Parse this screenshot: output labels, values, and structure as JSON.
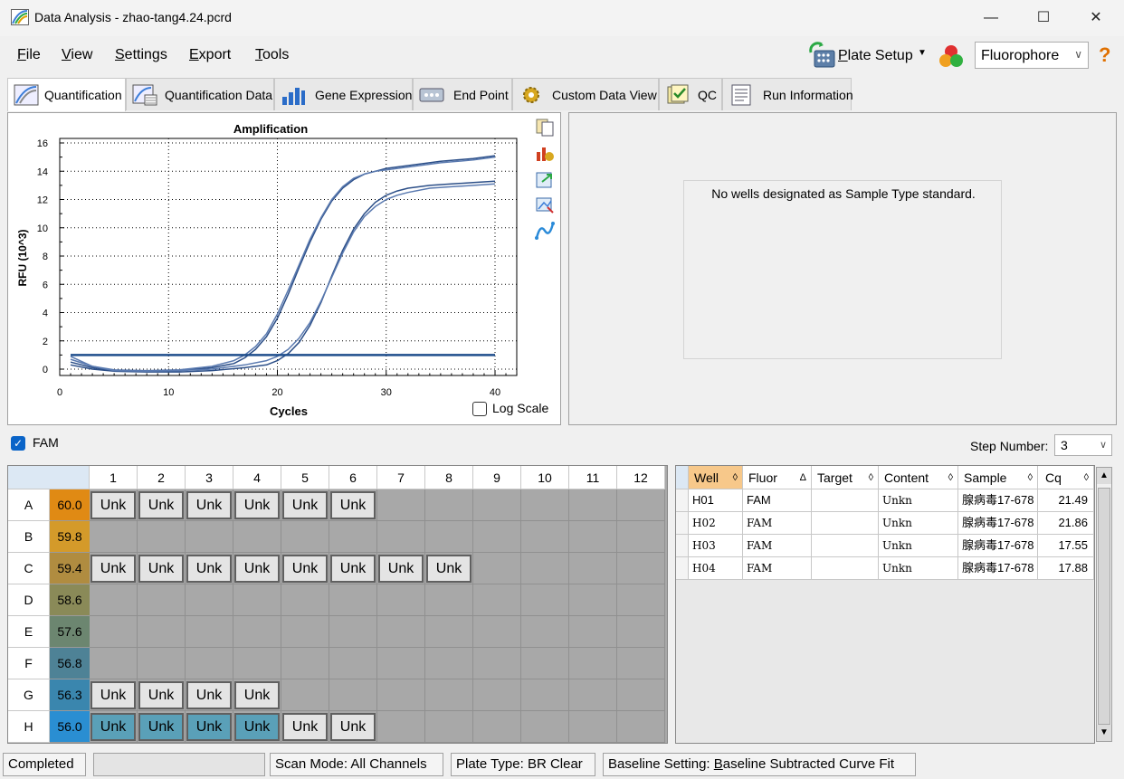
{
  "window": {
    "title": "Data Analysis - zhao-tang4.24.pcrd",
    "minimize": "—",
    "maximize": "☐",
    "close": "✕"
  },
  "menu": {
    "file": {
      "ul": "F",
      "rest": "ile"
    },
    "view": {
      "ul": "V",
      "rest": "iew"
    },
    "settings": {
      "ul": "S",
      "rest": "ettings"
    },
    "export": {
      "ul": "E",
      "rest": "xport"
    },
    "tools": {
      "ul": "T",
      "rest": "ools"
    }
  },
  "toolbar": {
    "plate_setup_ul": "P",
    "plate_setup_rest": "late Setup",
    "fluorophore": "Fluorophore",
    "help": "?"
  },
  "tabs": [
    {
      "label": "Quantification",
      "icon": "amplification-icon"
    },
    {
      "label": "Quantification Data",
      "icon": "quant-data-icon"
    },
    {
      "label": "Gene Expression",
      "icon": "bar-chart-icon"
    },
    {
      "label": "End Point",
      "icon": "end-point-icon"
    },
    {
      "label": "Custom Data View",
      "icon": "gear-icon"
    },
    {
      "label": "QC",
      "icon": "qc-check-icon"
    },
    {
      "label": "Run Information",
      "icon": "run-info-icon"
    }
  ],
  "chart_data": {
    "type": "line",
    "title": "Amplification",
    "xlabel": "Cycles",
    "ylabel": "RFU (10^3)",
    "xlim": [
      0,
      42
    ],
    "ylim": [
      -0.5,
      16
    ],
    "xticks": [
      0,
      10,
      20,
      30,
      40
    ],
    "yticks": [
      0,
      2,
      4,
      6,
      8,
      10,
      12,
      14,
      16
    ],
    "grid": true,
    "threshold": 1.0,
    "series": [
      {
        "x": [
          1,
          3,
          5,
          8,
          11,
          14,
          16,
          17,
          18,
          19,
          20,
          21,
          22,
          23,
          24,
          25,
          26,
          27,
          28,
          29,
          30,
          32,
          35,
          38,
          40
        ],
        "values": [
          0.5,
          0.1,
          -0.1,
          -0.15,
          -0.1,
          0.1,
          0.4,
          0.8,
          1.4,
          2.3,
          3.6,
          5.3,
          7.2,
          9.0,
          10.6,
          11.9,
          12.8,
          13.4,
          13.8,
          14.0,
          14.2,
          14.4,
          14.7,
          14.9,
          15.1
        ]
      },
      {
        "x": [
          1,
          3,
          5,
          8,
          11,
          14,
          16,
          17,
          18,
          19,
          20,
          21,
          22,
          23,
          24,
          25,
          26,
          27,
          28,
          29,
          30,
          32,
          35,
          38,
          40
        ],
        "values": [
          0.7,
          0.2,
          -0.05,
          -0.1,
          -0.05,
          0.2,
          0.6,
          1.0,
          1.6,
          2.5,
          3.9,
          5.6,
          7.4,
          9.2,
          10.7,
          12.0,
          12.9,
          13.5,
          13.8,
          14.0,
          14.1,
          14.3,
          14.6,
          14.8,
          15.0
        ]
      },
      {
        "x": [
          1,
          3,
          5,
          8,
          11,
          14,
          17,
          19,
          20,
          21,
          22,
          23,
          24,
          25,
          26,
          27,
          28,
          29,
          30,
          31,
          32,
          34,
          36,
          38,
          40
        ],
        "values": [
          0.3,
          0.0,
          -0.15,
          -0.2,
          -0.2,
          -0.1,
          0.1,
          0.3,
          0.6,
          1.1,
          1.9,
          3.1,
          4.7,
          6.6,
          8.4,
          9.9,
          11.0,
          11.8,
          12.3,
          12.6,
          12.8,
          13.0,
          13.1,
          13.2,
          13.3
        ]
      },
      {
        "x": [
          1,
          3,
          5,
          8,
          11,
          14,
          17,
          19,
          20,
          21,
          22,
          23,
          24,
          25,
          26,
          27,
          28,
          29,
          30,
          31,
          32,
          34,
          36,
          38,
          40
        ],
        "values": [
          0.9,
          0.2,
          -0.1,
          -0.15,
          -0.1,
          0.0,
          0.3,
          0.6,
          0.9,
          1.4,
          2.2,
          3.3,
          4.8,
          6.5,
          8.2,
          9.7,
          10.8,
          11.5,
          12.0,
          12.3,
          12.5,
          12.8,
          12.9,
          13.0,
          13.1
        ]
      }
    ]
  },
  "chart_controls": {
    "log_scale": "Log Scale"
  },
  "standard_curve": {
    "message": "No wells designated as Sample Type standard."
  },
  "fluor_filter": {
    "label": "FAM",
    "step_label": "Step Number:",
    "step_value": "3"
  },
  "plate": {
    "columns": [
      "1",
      "2",
      "3",
      "4",
      "5",
      "6",
      "7",
      "8",
      "9",
      "10",
      "11",
      "12"
    ],
    "rows": [
      {
        "label": "A",
        "temp": "60.0",
        "color": "#e08a14",
        "wells": [
          "Unk",
          "Unk",
          "Unk",
          "Unk",
          "Unk",
          "Unk",
          "",
          "",
          "",
          "",
          "",
          ""
        ],
        "hl": []
      },
      {
        "label": "B",
        "temp": "59.8",
        "color": "#d49a2a",
        "wells": [
          "",
          "",
          "",
          "",
          "",
          "",
          "",
          "",
          "",
          "",
          "",
          ""
        ],
        "hl": []
      },
      {
        "label": "C",
        "temp": "59.4",
        "color": "#b08c40",
        "wells": [
          "Unk",
          "Unk",
          "Unk",
          "Unk",
          "Unk",
          "Unk",
          "Unk",
          "Unk",
          "",
          "",
          "",
          ""
        ],
        "hl": []
      },
      {
        "label": "D",
        "temp": "58.6",
        "color": "#8a8a58",
        "wells": [
          "",
          "",
          "",
          "",
          "",
          "",
          "",
          "",
          "",
          "",
          "",
          ""
        ],
        "hl": []
      },
      {
        "label": "E",
        "temp": "57.6",
        "color": "#6c8670",
        "wells": [
          "",
          "",
          "",
          "",
          "",
          "",
          "",
          "",
          "",
          "",
          "",
          ""
        ],
        "hl": []
      },
      {
        "label": "F",
        "temp": "56.8",
        "color": "#4e8296",
        "wells": [
          "",
          "",
          "",
          "",
          "",
          "",
          "",
          "",
          "",
          "",
          "",
          ""
        ],
        "hl": []
      },
      {
        "label": "G",
        "temp": "56.3",
        "color": "#3a86ae",
        "wells": [
          "Unk",
          "Unk",
          "Unk",
          "Unk",
          "",
          "",
          "",
          "",
          "",
          "",
          "",
          ""
        ],
        "hl": []
      },
      {
        "label": "H",
        "temp": "56.0",
        "color": "#2a8ed2",
        "wells": [
          "Unk",
          "Unk",
          "Unk",
          "Unk",
          "Unk",
          "Unk",
          "",
          "",
          "",
          "",
          "",
          ""
        ],
        "hl": [
          0,
          1,
          2,
          3
        ]
      }
    ]
  },
  "table": {
    "headers": [
      {
        "label": "Well",
        "sort": "◊"
      },
      {
        "label": "Fluor",
        "sort": "Δ"
      },
      {
        "label": "Target",
        "sort": "◊"
      },
      {
        "label": "Content",
        "sort": "◊"
      },
      {
        "label": "Sample",
        "sort": "◊"
      },
      {
        "label": "Cq",
        "sort": "◊"
      }
    ],
    "rows": [
      {
        "well": "H01",
        "fluor": "FAM",
        "target": "",
        "content": "Unkn",
        "sample": "腺病毒17-678",
        "cq": "21.49"
      },
      {
        "well": "H02",
        "fluor": "FAM",
        "target": "",
        "content": "Unkn",
        "sample": "腺病毒17-678",
        "cq": "21.86"
      },
      {
        "well": "H03",
        "fluor": "FAM",
        "target": "",
        "content": "Unkn",
        "sample": "腺病毒17-678",
        "cq": "17.55"
      },
      {
        "well": "H04",
        "fluor": "FAM",
        "target": "",
        "content": "Unkn",
        "sample": "腺病毒17-678",
        "cq": "17.88"
      }
    ]
  },
  "status": {
    "state": "Completed",
    "progress": "",
    "scan_mode": "Scan Mode: All Channels",
    "plate_type": "Plate Type: BR Clear",
    "baseline_prefix": "Baseline Setting: ",
    "baseline_ul": "B",
    "baseline_rest": "aseline Subtracted Curve Fit"
  }
}
